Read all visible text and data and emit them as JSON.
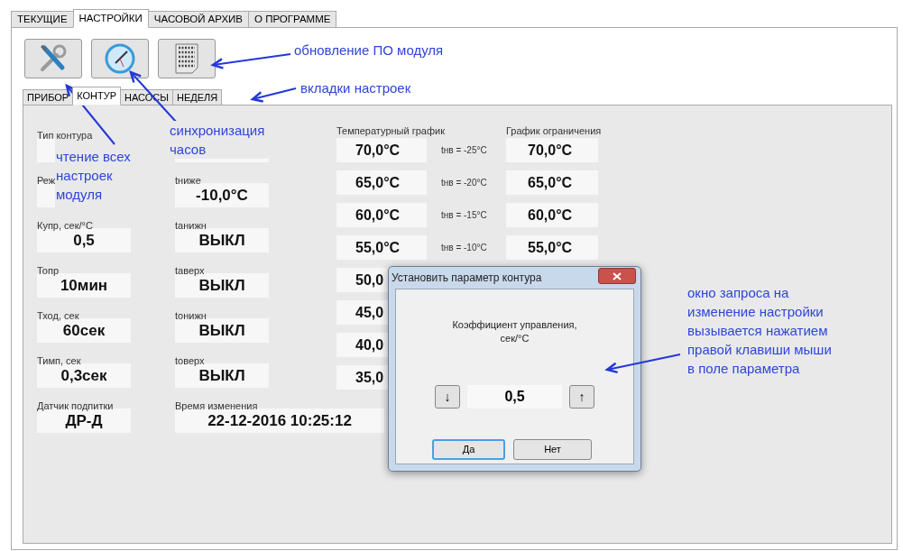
{
  "top_tabs": [
    {
      "label": "ТЕКУЩИЕ",
      "selected": false
    },
    {
      "label": "НАСТРОЙКИ",
      "selected": true
    },
    {
      "label": "ЧАСОВОЙ АРХИВ",
      "selected": false
    },
    {
      "label": "О ПРОГРАММЕ",
      "selected": false
    }
  ],
  "toolbar_buttons": [
    {
      "kind": "tools"
    },
    {
      "kind": "clock"
    },
    {
      "kind": "binary"
    }
  ],
  "sub_tabs": [
    {
      "label": "ПРИБОР",
      "selected": false
    },
    {
      "label": "КОНТУР",
      "selected": true
    },
    {
      "label": "НАСОСЫ",
      "selected": false
    },
    {
      "label": "НЕДЕЛЯ",
      "selected": false
    }
  ],
  "parameter_columns": [
    [
      {
        "label": "Тип контура"
      },
      {
        "label": "Реж"
      },
      {
        "label": "Купр, сек/°C",
        "value": "0,5"
      },
      {
        "label": "Топр",
        "value": "10мин"
      },
      {
        "label": "Тход, сек",
        "value": "60сек"
      },
      {
        "label": "Тимп, сек",
        "value": "0,3сек"
      },
      {
        "label": "Датчик подпитки",
        "value": "ДР-Д"
      }
    ],
    [
      {},
      {
        "label": "tниже",
        "value": "-10,0°C"
      },
      {
        "label": "tанижн",
        "value": "ВЫКЛ"
      },
      {
        "label": "tаверх",
        "value": "ВЫКЛ"
      },
      {
        "label": "tонижн",
        "value": "ВЫКЛ"
      },
      {
        "label": "tоверх",
        "value": "ВЫКЛ"
      },
      {
        "label": "Время изменения",
        "value": "22-12-2016 10:25:12",
        "kind": "wide"
      }
    ]
  ],
  "temperature_schedule": {
    "title": "Температурный график",
    "limit_title": "График ограничения",
    "rows": [
      {
        "temp": "70,0°C",
        "outdoor": "tнв = -25°C",
        "limit": "70,0°C"
      },
      {
        "temp": "65,0°C",
        "outdoor": "tнв = -20°C",
        "limit": "65,0°C"
      },
      {
        "temp": "60,0°C",
        "outdoor": "tнв = -15°C",
        "limit": "60,0°C"
      },
      {
        "temp": "55,0°C",
        "outdoor": "tнв = -10°C",
        "limit": "55,0°C"
      },
      {
        "temp": "50,0"
      },
      {
        "temp": "45,0"
      },
      {
        "temp": "40,0"
      },
      {
        "temp": "35,0"
      }
    ]
  },
  "dialog": {
    "title": "Установить параметр контура",
    "message": "Коэффициент управления,\nсек/°C",
    "down": "↓",
    "value": "0,5",
    "up": "↑",
    "buttons": [
      {
        "label": "Да",
        "focused": true
      },
      {
        "label": "Нет",
        "focused": false
      }
    ]
  },
  "annotations": [
    "обновление ПО модуля",
    "вкладки настроек",
    "чтение всех\nнастроек\nмодуля",
    "синхронизация\nчасов",
    "окно запроса на\nизменение настройки\nвызывается нажатием\nправой клавиши мыши\nв поле параметра"
  ]
}
